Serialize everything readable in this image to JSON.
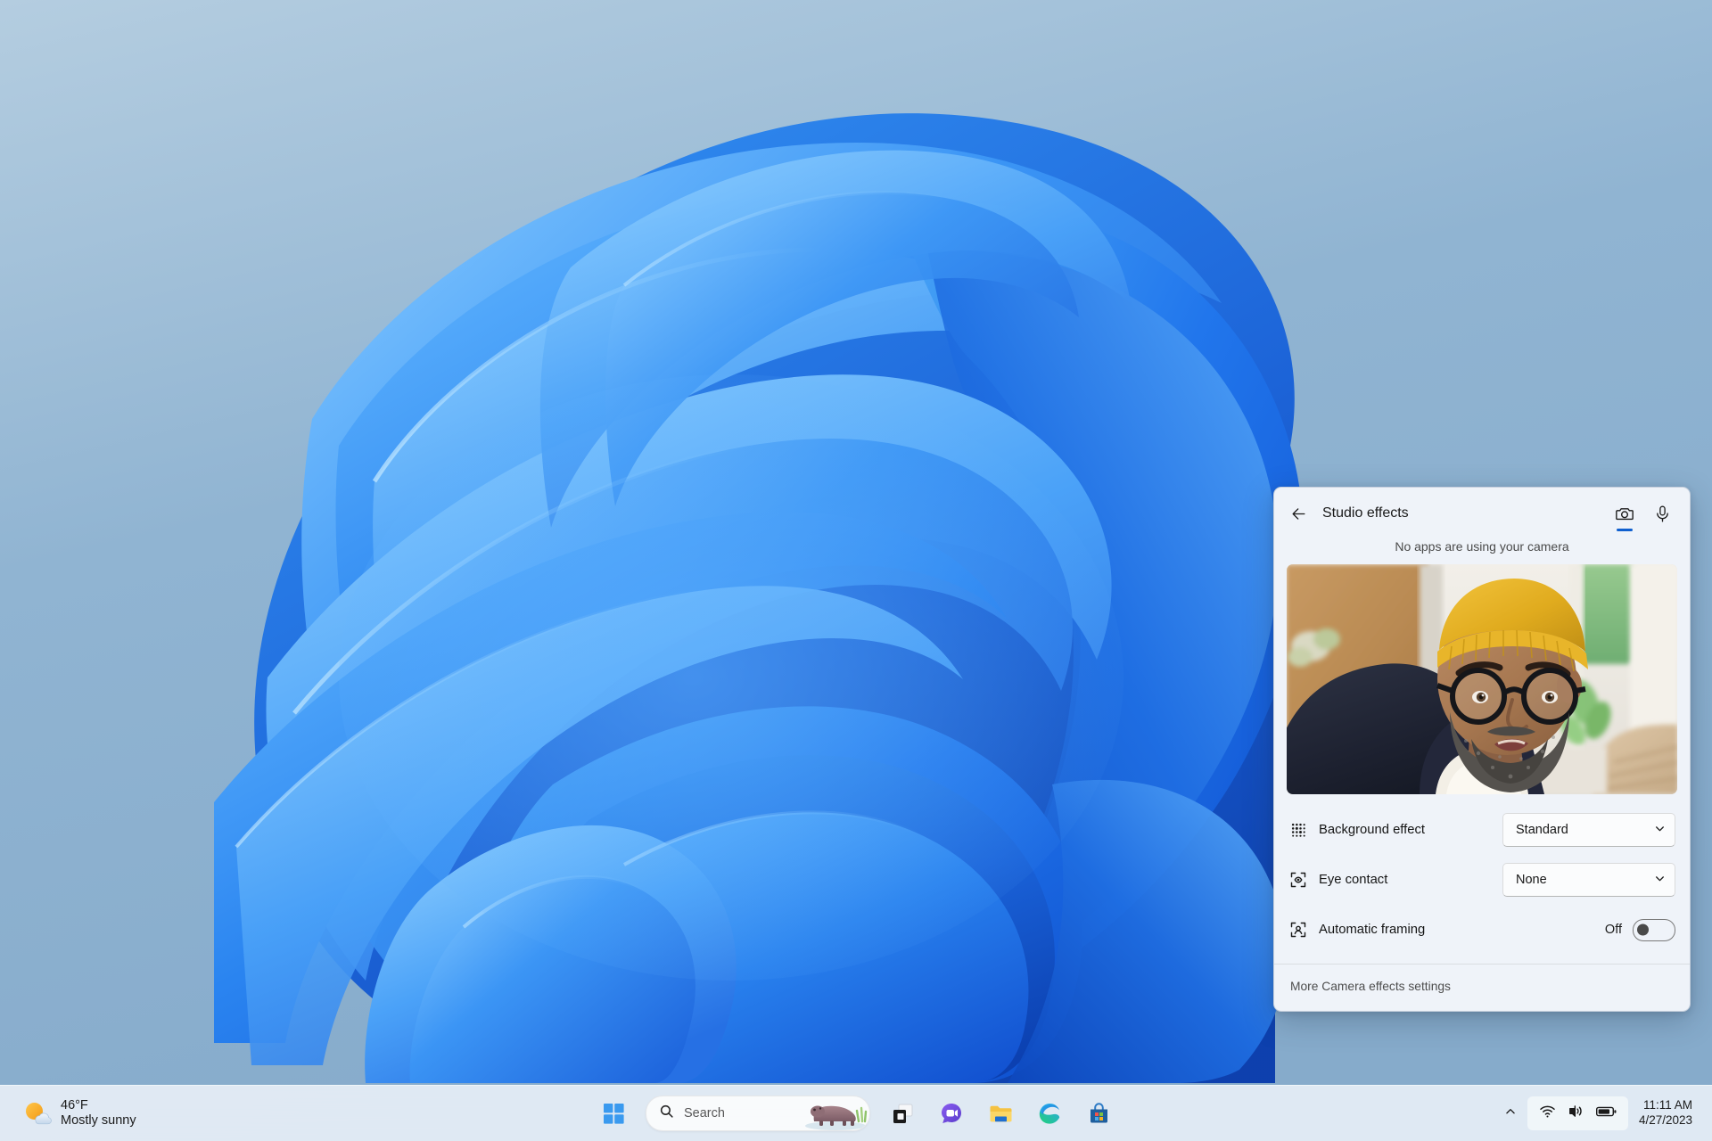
{
  "theme": {
    "accent": "#0f5fcf",
    "desktop_bg": "#8fb3d2",
    "taskbar_bg": "#ecf1f8",
    "panel_bg": "#eff3f9"
  },
  "desktop": {
    "wallpaper_name": "windows-11-bloom-wallpaper"
  },
  "taskbar": {
    "weather": {
      "temperature": "46°F",
      "condition": "Mostly sunny",
      "icon": "sun-behind-cloud-icon"
    },
    "start_label": "Start",
    "search": {
      "placeholder": "Search",
      "icon": "search-icon",
      "illustration": "hippopotamus-icon"
    },
    "apps": [
      {
        "name": "task-view",
        "label": "Task view"
      },
      {
        "name": "chat",
        "label": "Chat"
      },
      {
        "name": "file-explorer",
        "label": "File Explorer"
      },
      {
        "name": "edge",
        "label": "Microsoft Edge"
      },
      {
        "name": "store",
        "label": "Microsoft Store"
      }
    ],
    "tray": {
      "overflow_icon": "chevron-up-icon",
      "icons": [
        {
          "name": "wifi-icon",
          "label": "Network"
        },
        {
          "name": "speaker-muted-icon",
          "label": "Volume"
        },
        {
          "name": "battery-icon",
          "label": "Battery"
        }
      ],
      "time": "11:11 AM",
      "date": "4/27/2023"
    }
  },
  "studio_effects": {
    "back_icon": "back-arrow-icon",
    "title": "Studio effects",
    "tabs": [
      {
        "name": "camera",
        "icon": "camera-icon",
        "active": true
      },
      {
        "name": "microphone",
        "icon": "microphone-icon",
        "active": false
      }
    ],
    "status_text": "No apps are using your camera",
    "preview_alt": "camera-preview",
    "settings": [
      {
        "name": "background-effect",
        "icon": "blur-grid-icon",
        "label": "Background effect",
        "control": "dropdown",
        "value": "Standard",
        "chevron": "⌄"
      },
      {
        "name": "eye-contact",
        "icon": "eye-contact-icon",
        "label": "Eye contact",
        "control": "dropdown",
        "value": "None",
        "chevron": "⌄"
      },
      {
        "name": "automatic-framing",
        "icon": "framing-icon",
        "label": "Automatic framing",
        "control": "toggle",
        "value": "Off"
      }
    ],
    "footer_link": "More Camera effects settings"
  }
}
